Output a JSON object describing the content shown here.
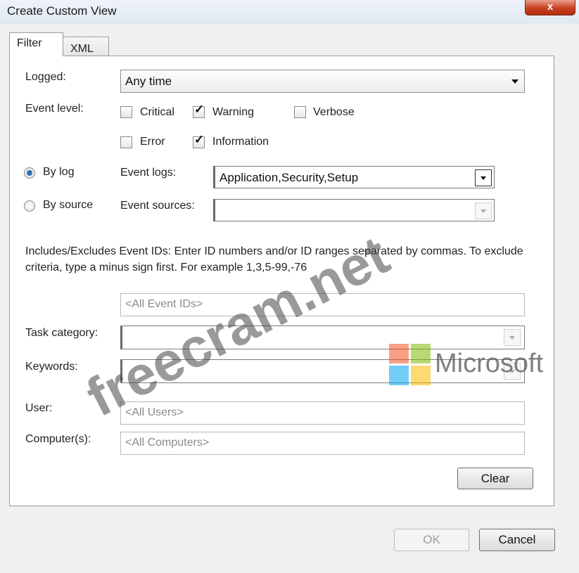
{
  "window": {
    "title": "Create Custom View",
    "close_glyph": "x"
  },
  "tabs": [
    {
      "label": "Filter",
      "active": true
    },
    {
      "label": "XML",
      "active": false
    }
  ],
  "filter": {
    "logged": {
      "label": "Logged:",
      "value": "Any time"
    },
    "event_level": {
      "label": "Event level:",
      "options": [
        {
          "label": "Critical",
          "checked": false
        },
        {
          "label": "Warning",
          "checked": true
        },
        {
          "label": "Verbose",
          "checked": false
        },
        {
          "label": "Error",
          "checked": false
        },
        {
          "label": "Information",
          "checked": true
        }
      ]
    },
    "by_log": {
      "label": "By log",
      "selected": true
    },
    "by_source": {
      "label": "By source",
      "selected": false
    },
    "event_logs": {
      "label": "Event logs:",
      "value": "Application,Security,Setup"
    },
    "event_sources": {
      "label": "Event sources:",
      "value": ""
    },
    "event_ids_description": "Includes/Excludes Event IDs: Enter ID numbers and/or ID ranges separated by commas. To exclude criteria, type a minus sign first. For example 1,3,5-99,-76",
    "event_ids_placeholder": "<All Event IDs>",
    "task_category": {
      "label": "Task category:",
      "value": ""
    },
    "keywords": {
      "label": "Keywords:",
      "value": ""
    },
    "user": {
      "label": "User:",
      "placeholder": "<All Users>"
    },
    "computers": {
      "label": "Computer(s):",
      "placeholder": "<All Computers>"
    },
    "clear_button": "Clear"
  },
  "footer": {
    "ok_button": "OK",
    "cancel_button": "Cancel"
  },
  "watermark": {
    "text": "freecram.net",
    "brand": "Microsoft",
    "logo_colors": [
      "#f25022",
      "#7fba00",
      "#00a4ef",
      "#ffb900"
    ]
  }
}
